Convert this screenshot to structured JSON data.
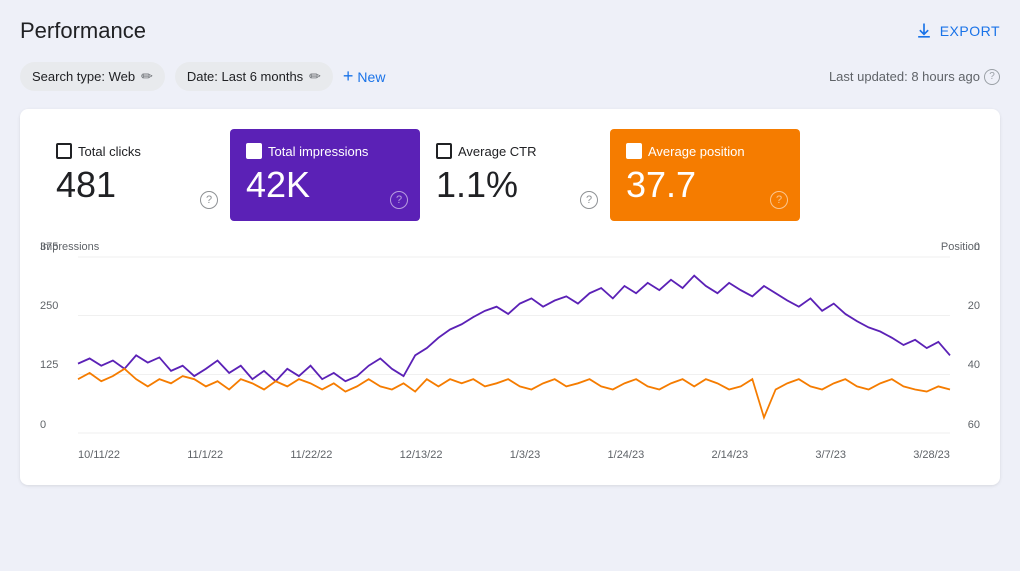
{
  "header": {
    "title": "Performance",
    "export_label": "EXPORT"
  },
  "toolbar": {
    "search_type_label": "Search type: Web",
    "date_label": "Date: Last 6 months",
    "new_label": "New",
    "last_updated": "Last updated: 8 hours ago"
  },
  "metrics": [
    {
      "id": "total-clicks",
      "label": "Total clicks",
      "value": "481",
      "style": "default",
      "checked": false
    },
    {
      "id": "total-impressions",
      "label": "Total impressions",
      "value": "42K",
      "style": "purple",
      "checked": true
    },
    {
      "id": "average-ctr",
      "label": "Average CTR",
      "value": "1.1%",
      "style": "default",
      "checked": false
    },
    {
      "id": "average-position",
      "label": "Average position",
      "value": "37.7",
      "style": "orange",
      "checked": true
    }
  ],
  "chart": {
    "y_axis_left_title": "Impressions",
    "y_axis_right_title": "Position",
    "y_left_labels": [
      "375",
      "250",
      "125",
      "0"
    ],
    "y_right_labels": [
      "0",
      "20",
      "40",
      "60"
    ],
    "x_labels": [
      "10/11/22",
      "11/1/22",
      "11/22/22",
      "12/13/22",
      "1/3/23",
      "1/24/23",
      "2/14/23",
      "3/7/23",
      "3/28/23"
    ],
    "purple_line_color": "#5b21b6",
    "orange_line_color": "#f57c00"
  }
}
